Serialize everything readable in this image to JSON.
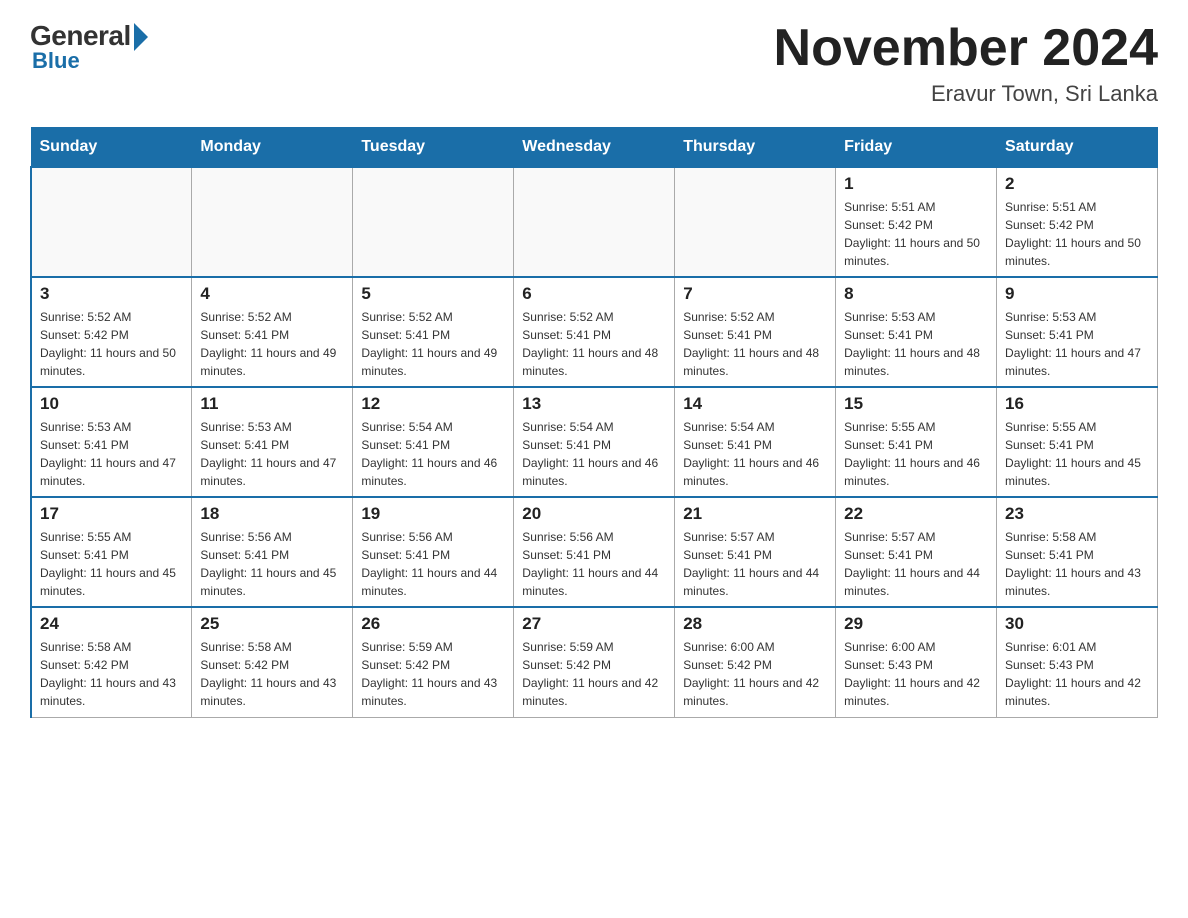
{
  "logo": {
    "general": "General",
    "blue": "Blue"
  },
  "header": {
    "month": "November 2024",
    "location": "Eravur Town, Sri Lanka"
  },
  "weekdays": [
    "Sunday",
    "Monday",
    "Tuesday",
    "Wednesday",
    "Thursday",
    "Friday",
    "Saturday"
  ],
  "weeks": [
    [
      {
        "day": "",
        "info": ""
      },
      {
        "day": "",
        "info": ""
      },
      {
        "day": "",
        "info": ""
      },
      {
        "day": "",
        "info": ""
      },
      {
        "day": "",
        "info": ""
      },
      {
        "day": "1",
        "info": "Sunrise: 5:51 AM\nSunset: 5:42 PM\nDaylight: 11 hours and 50 minutes."
      },
      {
        "day": "2",
        "info": "Sunrise: 5:51 AM\nSunset: 5:42 PM\nDaylight: 11 hours and 50 minutes."
      }
    ],
    [
      {
        "day": "3",
        "info": "Sunrise: 5:52 AM\nSunset: 5:42 PM\nDaylight: 11 hours and 50 minutes."
      },
      {
        "day": "4",
        "info": "Sunrise: 5:52 AM\nSunset: 5:41 PM\nDaylight: 11 hours and 49 minutes."
      },
      {
        "day": "5",
        "info": "Sunrise: 5:52 AM\nSunset: 5:41 PM\nDaylight: 11 hours and 49 minutes."
      },
      {
        "day": "6",
        "info": "Sunrise: 5:52 AM\nSunset: 5:41 PM\nDaylight: 11 hours and 48 minutes."
      },
      {
        "day": "7",
        "info": "Sunrise: 5:52 AM\nSunset: 5:41 PM\nDaylight: 11 hours and 48 minutes."
      },
      {
        "day": "8",
        "info": "Sunrise: 5:53 AM\nSunset: 5:41 PM\nDaylight: 11 hours and 48 minutes."
      },
      {
        "day": "9",
        "info": "Sunrise: 5:53 AM\nSunset: 5:41 PM\nDaylight: 11 hours and 47 minutes."
      }
    ],
    [
      {
        "day": "10",
        "info": "Sunrise: 5:53 AM\nSunset: 5:41 PM\nDaylight: 11 hours and 47 minutes."
      },
      {
        "day": "11",
        "info": "Sunrise: 5:53 AM\nSunset: 5:41 PM\nDaylight: 11 hours and 47 minutes."
      },
      {
        "day": "12",
        "info": "Sunrise: 5:54 AM\nSunset: 5:41 PM\nDaylight: 11 hours and 46 minutes."
      },
      {
        "day": "13",
        "info": "Sunrise: 5:54 AM\nSunset: 5:41 PM\nDaylight: 11 hours and 46 minutes."
      },
      {
        "day": "14",
        "info": "Sunrise: 5:54 AM\nSunset: 5:41 PM\nDaylight: 11 hours and 46 minutes."
      },
      {
        "day": "15",
        "info": "Sunrise: 5:55 AM\nSunset: 5:41 PM\nDaylight: 11 hours and 46 minutes."
      },
      {
        "day": "16",
        "info": "Sunrise: 5:55 AM\nSunset: 5:41 PM\nDaylight: 11 hours and 45 minutes."
      }
    ],
    [
      {
        "day": "17",
        "info": "Sunrise: 5:55 AM\nSunset: 5:41 PM\nDaylight: 11 hours and 45 minutes."
      },
      {
        "day": "18",
        "info": "Sunrise: 5:56 AM\nSunset: 5:41 PM\nDaylight: 11 hours and 45 minutes."
      },
      {
        "day": "19",
        "info": "Sunrise: 5:56 AM\nSunset: 5:41 PM\nDaylight: 11 hours and 44 minutes."
      },
      {
        "day": "20",
        "info": "Sunrise: 5:56 AM\nSunset: 5:41 PM\nDaylight: 11 hours and 44 minutes."
      },
      {
        "day": "21",
        "info": "Sunrise: 5:57 AM\nSunset: 5:41 PM\nDaylight: 11 hours and 44 minutes."
      },
      {
        "day": "22",
        "info": "Sunrise: 5:57 AM\nSunset: 5:41 PM\nDaylight: 11 hours and 44 minutes."
      },
      {
        "day": "23",
        "info": "Sunrise: 5:58 AM\nSunset: 5:41 PM\nDaylight: 11 hours and 43 minutes."
      }
    ],
    [
      {
        "day": "24",
        "info": "Sunrise: 5:58 AM\nSunset: 5:42 PM\nDaylight: 11 hours and 43 minutes."
      },
      {
        "day": "25",
        "info": "Sunrise: 5:58 AM\nSunset: 5:42 PM\nDaylight: 11 hours and 43 minutes."
      },
      {
        "day": "26",
        "info": "Sunrise: 5:59 AM\nSunset: 5:42 PM\nDaylight: 11 hours and 43 minutes."
      },
      {
        "day": "27",
        "info": "Sunrise: 5:59 AM\nSunset: 5:42 PM\nDaylight: 11 hours and 42 minutes."
      },
      {
        "day": "28",
        "info": "Sunrise: 6:00 AM\nSunset: 5:42 PM\nDaylight: 11 hours and 42 minutes."
      },
      {
        "day": "29",
        "info": "Sunrise: 6:00 AM\nSunset: 5:43 PM\nDaylight: 11 hours and 42 minutes."
      },
      {
        "day": "30",
        "info": "Sunrise: 6:01 AM\nSunset: 5:43 PM\nDaylight: 11 hours and 42 minutes."
      }
    ]
  ]
}
